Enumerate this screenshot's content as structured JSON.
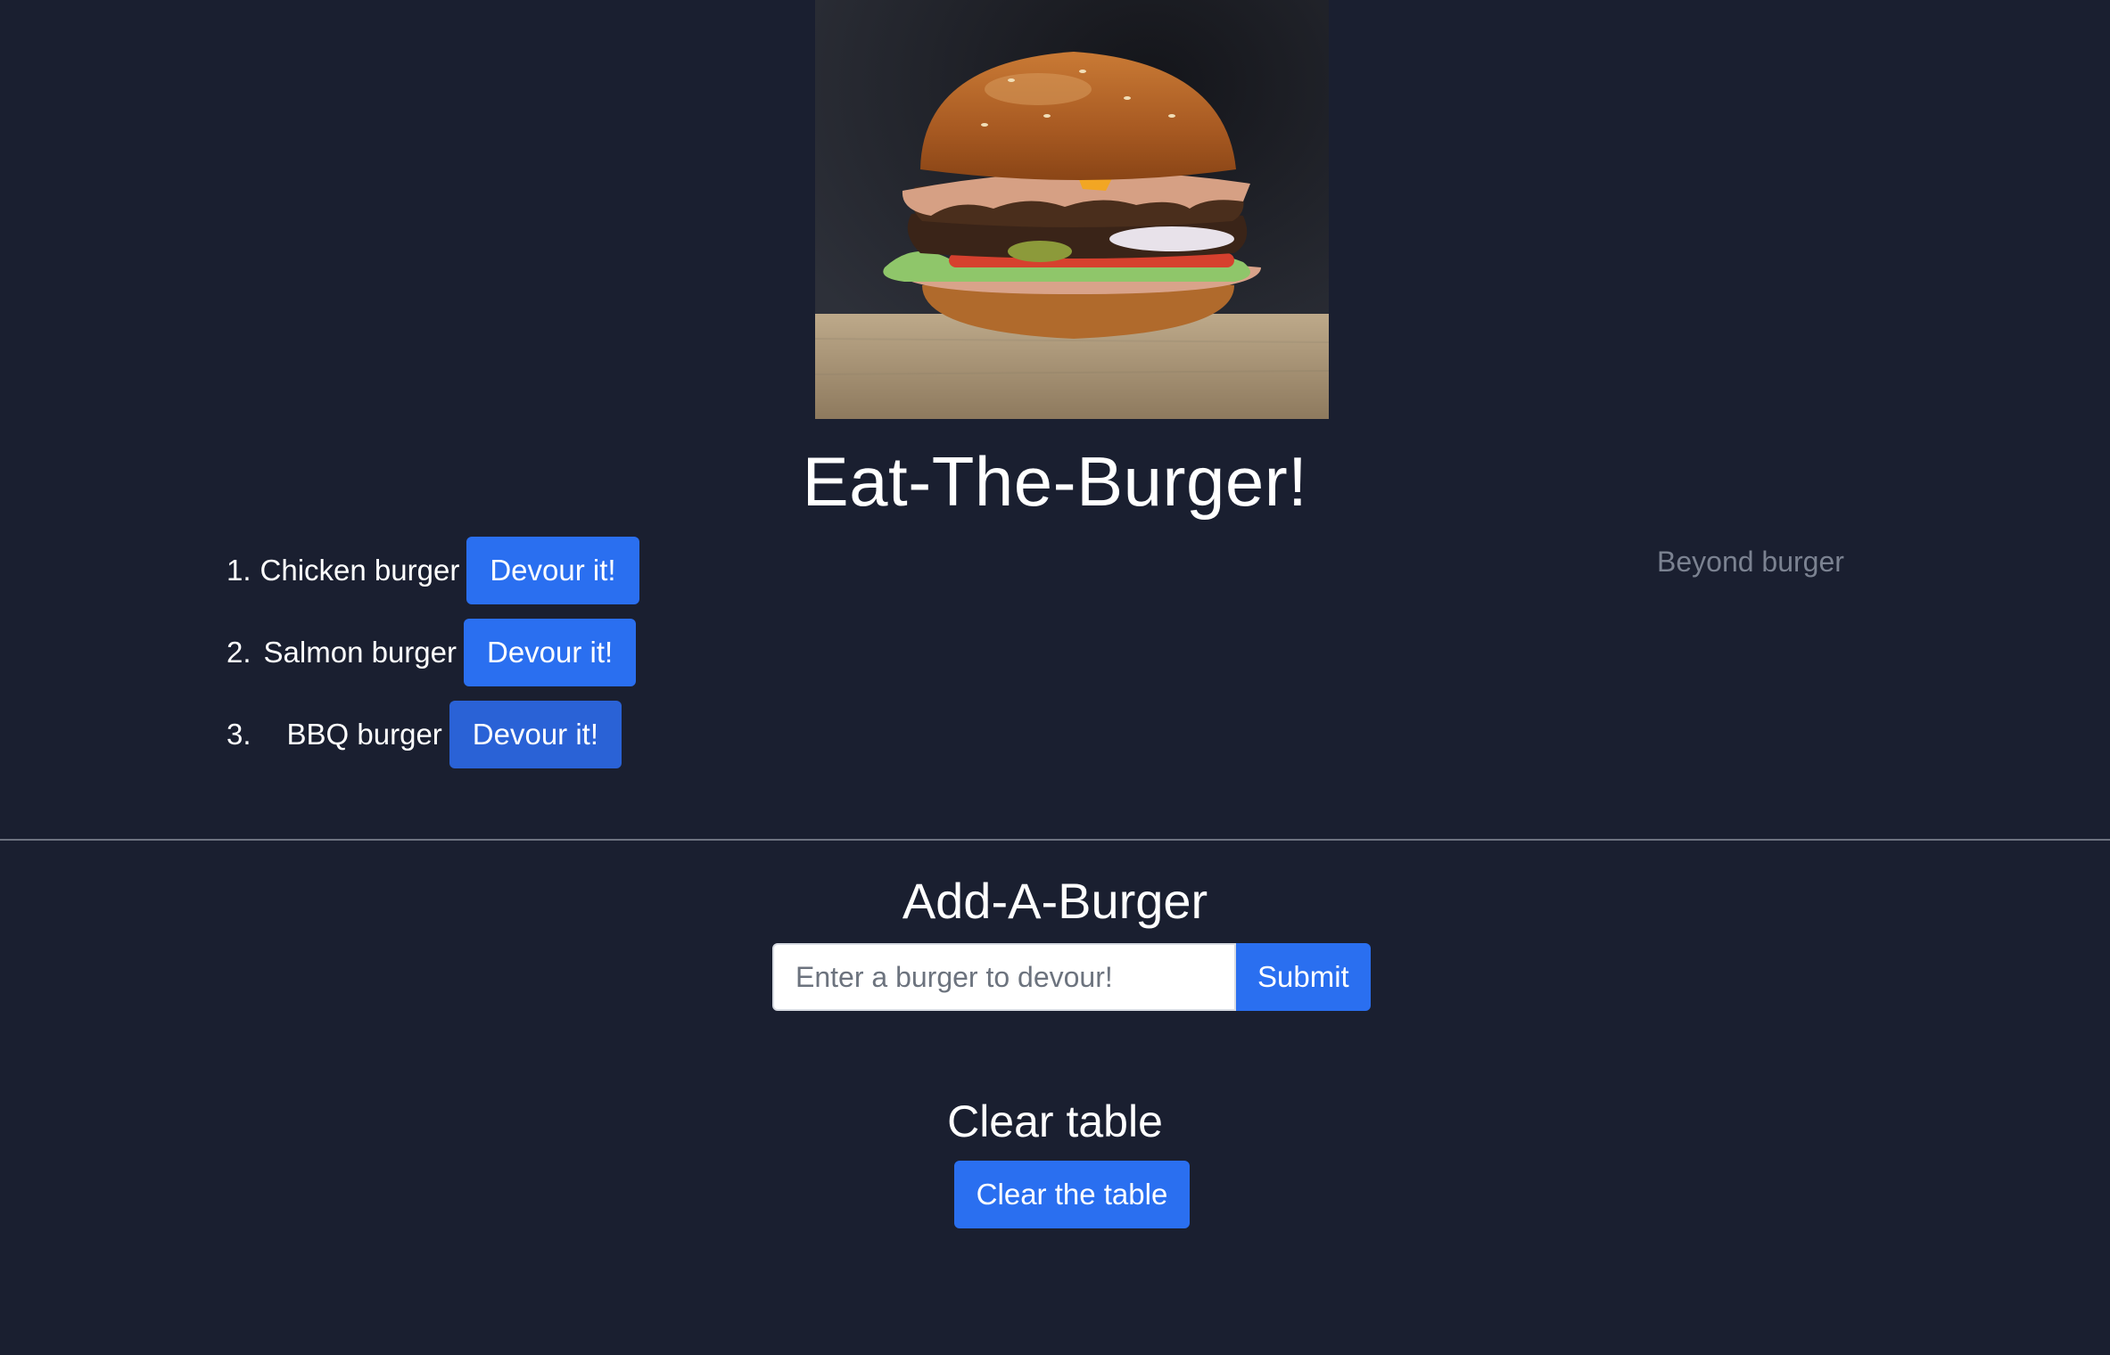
{
  "header": {
    "title": "Eat-The-Burger!"
  },
  "burgers": [
    {
      "number": "1.",
      "name": "Chicken burger",
      "button": "Devour it!"
    },
    {
      "number": "2.",
      "name": "Salmon burger",
      "button": "Devour it!"
    },
    {
      "number": "3.",
      "name": "BBQ burger",
      "button": "Devour it!"
    }
  ],
  "devoured": [
    {
      "name": "Beyond burger"
    }
  ],
  "add_section": {
    "title": "Add-A-Burger",
    "input_placeholder": "Enter a burger to devour!",
    "input_value": "",
    "submit_label": "Submit"
  },
  "clear_section": {
    "title": "Clear table",
    "button_label": "Clear the table"
  },
  "colors": {
    "background": "#1a1f30",
    "button": "#2a6ff0",
    "devoured_text": "#7b8291"
  }
}
